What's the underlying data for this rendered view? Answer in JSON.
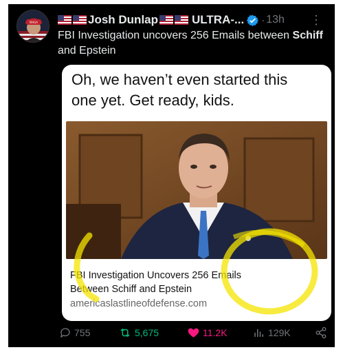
{
  "author": {
    "display_name": "Josh Dunlap",
    "badge_text": "ULTRA-...",
    "verified_icon": "verified-badge-icon",
    "timestamp": "13h",
    "separator": "·"
  },
  "tweet": {
    "text_part1": "FBI Investigation uncovers 256 Emails between ",
    "text_bold": "Schiff",
    "text_part2": " and Epstein"
  },
  "media": {
    "quote_line1": "Oh, we haven’t even started this",
    "quote_line2": "one yet. Get ready, kids.",
    "article_title_line1": "FBI Investigation Uncovers 256 Emails",
    "article_title_line2": "Between Schiff and Epstein",
    "article_domain": "americaslastlineofdefense.com"
  },
  "actions": {
    "replies": "755",
    "reposts": "5,675",
    "likes": "11.2K",
    "views": "129K"
  },
  "colors": {
    "background": "#000000",
    "text": "#e7e9ea",
    "muted": "#71767b",
    "verified": "#1d9bf0",
    "repost_active": "#00ba7c",
    "like_active": "#f91880"
  }
}
